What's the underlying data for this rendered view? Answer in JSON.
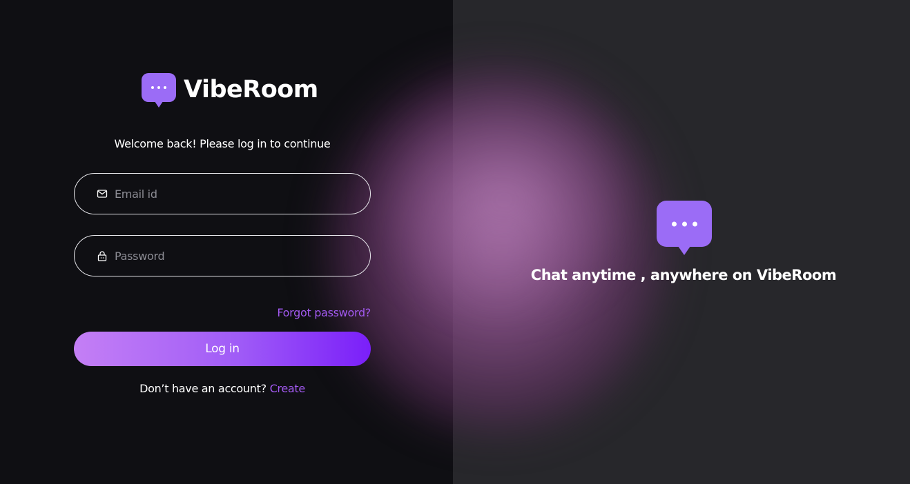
{
  "app": {
    "name": "ViBeRoom"
  },
  "brand": {
    "logo_text": "VibeRoom",
    "logo_icon": "chat-bubble-dots-icon",
    "accent_color": "#9b6cf6",
    "link_color": "#a259f0"
  },
  "login": {
    "welcome_text": "Welcome back! Please log in to continue",
    "email": {
      "placeholder": "Email id",
      "value": "",
      "icon": "mail-icon"
    },
    "password": {
      "placeholder": "Password",
      "value": "",
      "icon": "lock-icon"
    },
    "forgot_label": "Forgot password?",
    "login_label": "Log in",
    "signup_prompt": "Don’t have an account?",
    "signup_link": "Create"
  },
  "hero": {
    "icon": "chat-bubble-dots-icon",
    "tagline": "Chat anytime , anywhere on VibeRoom"
  }
}
